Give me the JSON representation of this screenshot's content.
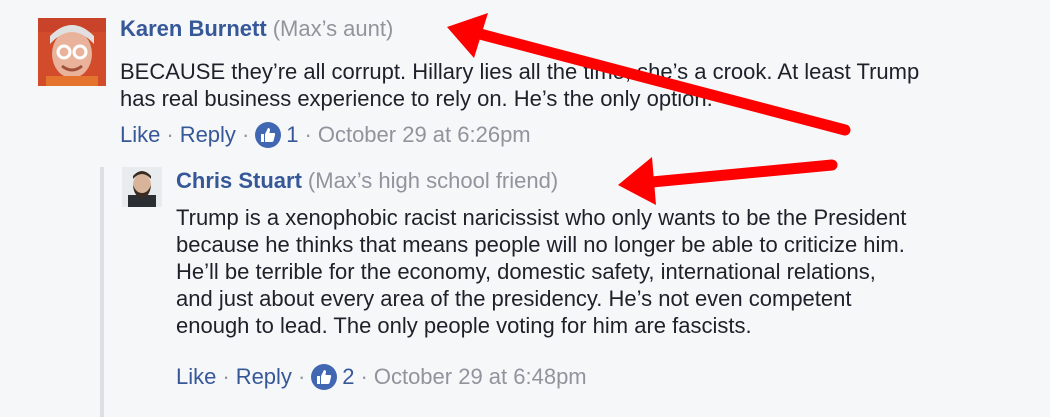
{
  "comments": [
    {
      "author": "Karen Burnett",
      "relation": "(Max’s aunt)",
      "text_lines": [
        "BECAUSE they’re all corrupt. Hillary lies all the time, she’s a crook. At least Trump",
        "has real business experience to rely on. He’s the only option."
      ],
      "like_label": "Like",
      "reply_label": "Reply",
      "like_count": "1",
      "timestamp": "October 29 at 6:26pm",
      "avatar_icon": "elderly-woman-avatar"
    },
    {
      "author": "Chris Stuart",
      "relation": "(Max’s high school friend)",
      "text_lines": [
        "Trump is a xenophobic racist naricissist who only wants to be the President",
        "because he thinks that means people will no longer be able to criticize him.",
        "He’ll be terrible for the economy, domestic safety, international relations,",
        "and just about every area of the presidency. He’s not even competent",
        "enough to lead. The only people voting for him are fascists."
      ],
      "like_label": "Like",
      "reply_label": "Reply",
      "like_count": "2",
      "timestamp": "October 29 at 6:48pm",
      "avatar_icon": "bearded-man-avatar"
    }
  ],
  "colors": {
    "background": "#f6f7f9",
    "link": "#365899",
    "muted": "#90949c",
    "text": "#1d2129",
    "like_badge": "#4267b2",
    "annotation_arrow": "#ff0000"
  },
  "separator": "·"
}
